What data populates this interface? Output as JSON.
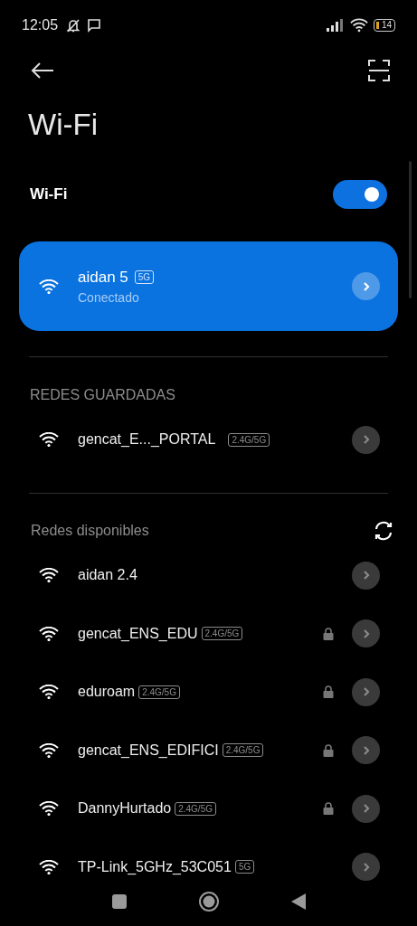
{
  "status_bar": {
    "time": "12:05",
    "battery": "14"
  },
  "title": "Wi-Fi",
  "wifi_toggle": {
    "label": "Wi-Fi",
    "on": true
  },
  "connected": {
    "name": "aidan 5",
    "band": "5G",
    "status": "Conectado"
  },
  "saved": {
    "heading": "REDES GUARDADAS",
    "networks": [
      {
        "name": "gencat_E..._PORTAL",
        "band": "2.4G/5G",
        "locked": false
      }
    ]
  },
  "available": {
    "heading": "Redes disponibles",
    "networks": [
      {
        "name": "aidan 2.4",
        "locked": false
      },
      {
        "name": "gencat_ENS_EDU",
        "band": "2.4G/5G",
        "locked": true
      },
      {
        "name": "eduroam",
        "band": "2.4G/5G",
        "locked": true
      },
      {
        "name": "gencat_ENS_EDIFICI",
        "band": "2.4G/5G",
        "locked": true
      },
      {
        "name": "DannyHurtado",
        "band": "2.4G/5G",
        "locked": true
      },
      {
        "name": "TP-Link_5GHz_53C051",
        "band": "5G",
        "locked": false
      }
    ]
  }
}
